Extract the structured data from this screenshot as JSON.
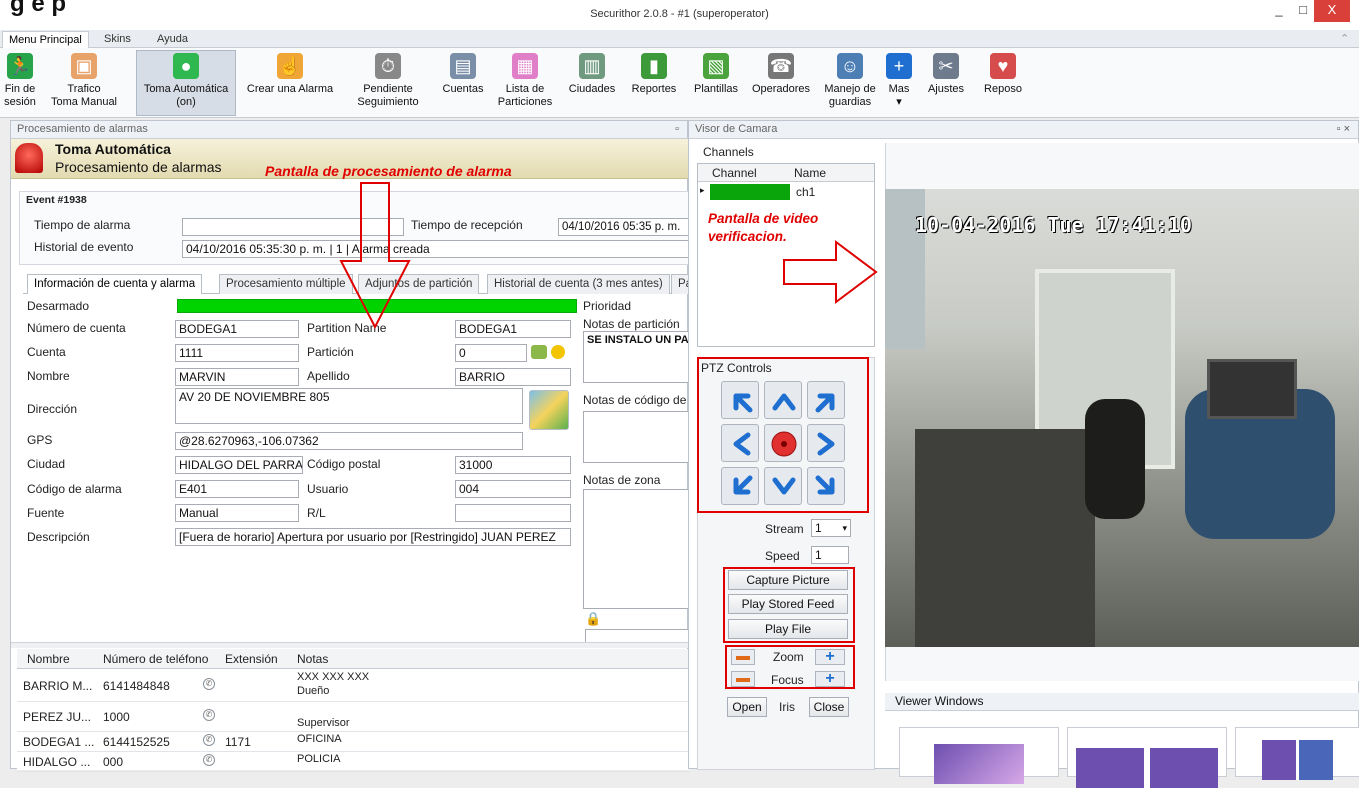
{
  "heading": "g e p",
  "app_title": "Securithor 2.0.8  -  #1 (superoperator)",
  "window_buttons": [
    "_",
    "□",
    "X"
  ],
  "menu_tabs": [
    "Menu Principal",
    "Skins",
    "Ayuda"
  ],
  "ribbon": [
    {
      "label": "Fin de\nsesión",
      "icon": "runner-icon",
      "color": "#27a34a",
      "glyph": "🏃"
    },
    {
      "label": "Trafico\nToma Manual",
      "icon": "traffic-icon",
      "color": "#e8a36b",
      "glyph": "▣"
    },
    {
      "label": "Toma Automática\n(on)",
      "icon": "siren-icon",
      "color": "#2fb84f",
      "glyph": "●"
    },
    {
      "label": "Crear una Alarma",
      "icon": "hand-icon",
      "color": "#f0a636",
      "glyph": "☝"
    },
    {
      "label": "Pendiente\nSeguimiento",
      "icon": "stopwatch-icon",
      "color": "#888",
      "glyph": "⏱"
    },
    {
      "label": "Cuentas",
      "icon": "accounts-icon",
      "color": "#7a8ea8",
      "glyph": "▤"
    },
    {
      "label": "Lista de\nParticiones",
      "icon": "partitions-icon",
      "color": "#e07fc7",
      "glyph": "▦"
    },
    {
      "label": "Ciudades",
      "icon": "cities-icon",
      "color": "#6f9a7f",
      "glyph": "▥"
    },
    {
      "label": "Reportes",
      "icon": "reports-icon",
      "color": "#3c9a3a",
      "glyph": "▮"
    },
    {
      "label": "Plantillas",
      "icon": "templates-icon",
      "color": "#4aa33c",
      "glyph": "▧"
    },
    {
      "label": "Operadores",
      "icon": "operators-icon",
      "color": "#777",
      "glyph": "☎"
    },
    {
      "label": "Manejo de\nguardias",
      "icon": "guard-icon",
      "color": "#4d7fb5",
      "glyph": "☺"
    },
    {
      "label": "Mas\n▾",
      "icon": "plus-icon",
      "color": "#1f6fd1",
      "glyph": "+"
    },
    {
      "label": "Ajustes",
      "icon": "settings-icon",
      "color": "#6d7b8d",
      "glyph": "✂"
    },
    {
      "label": "Reposo",
      "icon": "heart-icon",
      "color": "#d64b4b",
      "glyph": "♥"
    }
  ],
  "left": {
    "panel_title": "Procesamiento de alarmas",
    "banner_title": "Toma Automática",
    "banner_subtitle": "Procesamiento de alarmas",
    "annotation": "Pantalla de procesamiento de alarma",
    "event": "Event #1938",
    "tiempo_alarma_label": "Tiempo de alarma",
    "tiempo_alarma_value": "",
    "tiempo_recepcion_label": "Tiempo de recepción",
    "tiempo_recepcion_value": "04/10/2016 05:35 p. m.",
    "historial_label": "Historial de evento",
    "historial_value": "04/10/2016 05:35:30 p. m. | 1 | Alarma creada",
    "tabs": [
      "Información de cuenta y alarma",
      "Procesamiento múltiple",
      "Adjuntos de partición",
      "Historial de cuenta (3 mes antes)",
      "Pat"
    ],
    "fields": {
      "desarmado": "Desarmado",
      "numero_cuenta_label": "Número de cuenta",
      "numero_cuenta": "BODEGA1",
      "partition_name_label": "Partition Name",
      "partition_name": "BODEGA1",
      "cuenta_label": "Cuenta",
      "cuenta": "1111",
      "particion_label": "Partición",
      "particion": "0",
      "nombre_label": "Nombre",
      "nombre": "MARVIN",
      "apellido_label": "Apellido",
      "apellido": "BARRIO",
      "direccion_label": "Dirección",
      "direccion": "AV 20 DE  NOVIEMBRE 805",
      "gps_label": "GPS",
      "gps": "@28.6270963,-106.07362",
      "ciudad_label": "Ciudad",
      "ciudad": "HIDALGO DEL PARRA",
      "codigo_postal_label": "Código postal",
      "codigo_postal": "31000",
      "codigo_alarma_label": "Código de alarma",
      "codigo_alarma": "E401",
      "usuario_label": "Usuario",
      "usuario": "004",
      "fuente_label": "Fuente",
      "fuente": "Manual",
      "rl_label": "R/L",
      "rl": "",
      "descripcion_label": "Descripción",
      "descripcion": "[Fuera de horario] Apertura por usuario por [Restringido] JUAN PEREZ"
    },
    "notes": {
      "prioridad": "Prioridad",
      "notas_particion": "Notas de partición",
      "notas_particion_value": "SE INSTALO UN PA",
      "notas_codigo": "Notas de código de",
      "notas_zona": "Notas de zona"
    },
    "contacts_headers": [
      "Nombre",
      "Número de teléfono",
      "Extensión",
      "Notas"
    ],
    "contacts": [
      {
        "nombre": "BARRIO M...",
        "telefono": "6141484848",
        "extension": "",
        "notas": "XXX XXX XXX",
        "notas2": "Dueño"
      },
      {
        "nombre": "PEREZ JU...",
        "telefono": "1000",
        "extension": "",
        "notas": "",
        "notas2": "Supervisor"
      },
      {
        "nombre": "BODEGA1 ...",
        "telefono": "6144152525",
        "extension": "1171",
        "notas": "OFICINA",
        "notas2": ""
      },
      {
        "nombre": "HIDALGO ...",
        "telefono": "000",
        "extension": "",
        "notas": "POLICIA",
        "notas2": ""
      }
    ]
  },
  "right": {
    "panel_title": "Visor de Camara",
    "channels_label": "Channels",
    "channels_headers": [
      "Channel",
      "Name"
    ],
    "channel_name": "ch1",
    "annotation": "Pantalla de video\nverificacion.",
    "ptz_label": "PTZ Controls",
    "stream_label": "Stream",
    "stream_value": "1",
    "speed_label": "Speed",
    "speed_value": "1",
    "capture": "Capture Picture",
    "play_stored": "Play Stored Feed",
    "play_file": "Play File",
    "zoom": "Zoom",
    "focus": "Focus",
    "open": "Open",
    "iris": "Iris",
    "close": "Close",
    "video_timestamp": "10-04-2016 Tue 17:41:10",
    "viewer_windows": "Viewer Windows"
  }
}
